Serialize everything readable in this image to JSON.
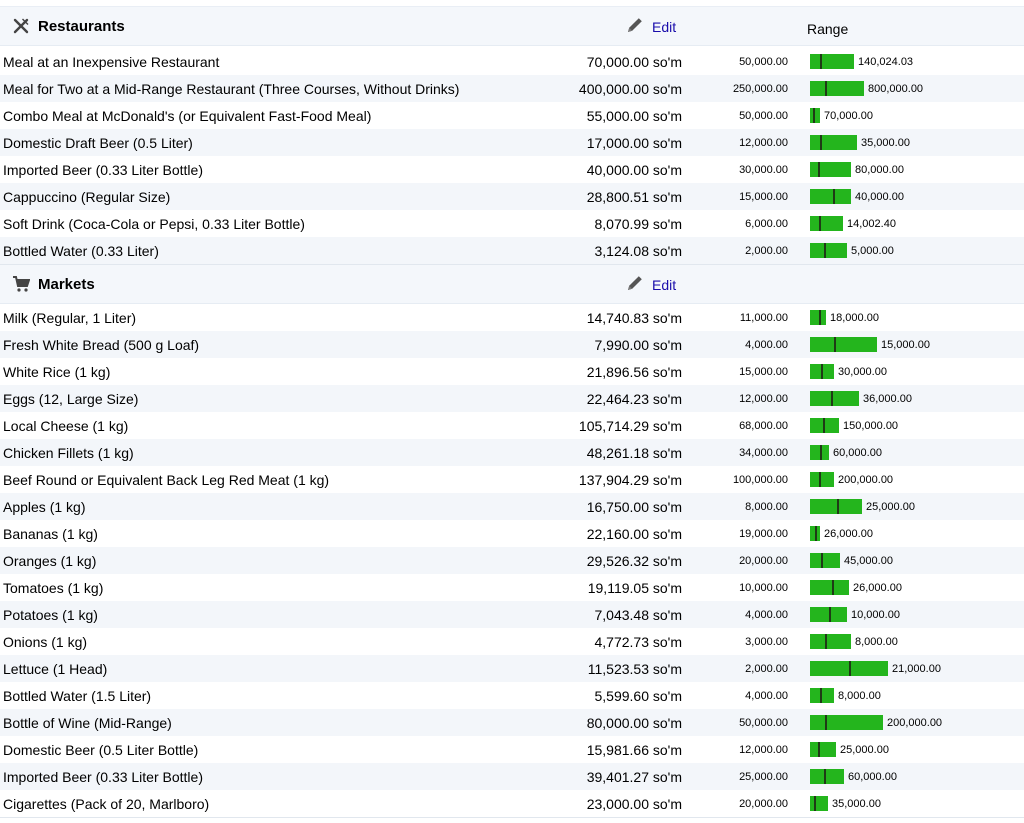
{
  "colors": {
    "bar": "#24b51d",
    "marker": "#1f3a16",
    "link": "#1a0dab"
  },
  "sections": [
    {
      "id": "restaurants",
      "title": "Restaurants",
      "icon": "restaurant-icon",
      "edit_label": "Edit",
      "range_header": "Range",
      "rows": [
        {
          "item": "Meal at an Inexpensive Restaurant",
          "price": "70,000.00 so'm",
          "min": "50,000.00",
          "max": "140,024.03",
          "min_v": 50000,
          "max_v": 140024.03,
          "price_v": 70000
        },
        {
          "item": "Meal for Two at a Mid-Range Restaurant (Three Courses, Without Drinks)",
          "price": "400,000.00 so'm",
          "min": "250,000.00",
          "max": "800,000.00",
          "min_v": 250000,
          "max_v": 800000,
          "price_v": 400000
        },
        {
          "item": "Combo Meal at McDonald's (or Equivalent Fast-Food Meal)",
          "price": "55,000.00 so'm",
          "min": "50,000.00",
          "max": "70,000.00",
          "min_v": 50000,
          "max_v": 70000,
          "price_v": 55000
        },
        {
          "item": "Domestic Draft Beer (0.5 Liter)",
          "price": "17,000.00 so'm",
          "min": "12,000.00",
          "max": "35,000.00",
          "min_v": 12000,
          "max_v": 35000,
          "price_v": 17000
        },
        {
          "item": "Imported Beer (0.33 Liter Bottle)",
          "price": "40,000.00 so'm",
          "min": "30,000.00",
          "max": "80,000.00",
          "min_v": 30000,
          "max_v": 80000,
          "price_v": 40000
        },
        {
          "item": "Cappuccino (Regular Size)",
          "price": "28,800.51 so'm",
          "min": "15,000.00",
          "max": "40,000.00",
          "min_v": 15000,
          "max_v": 40000,
          "price_v": 28800.51
        },
        {
          "item": "Soft Drink (Coca-Cola or Pepsi, 0.33 Liter Bottle)",
          "price": "8,070.99 so'm",
          "min": "6,000.00",
          "max": "14,002.40",
          "min_v": 6000,
          "max_v": 14002.4,
          "price_v": 8070.99
        },
        {
          "item": "Bottled Water (0.33 Liter)",
          "price": "3,124.08 so'm",
          "min": "2,000.00",
          "max": "5,000.00",
          "min_v": 2000,
          "max_v": 5000,
          "price_v": 3124.08
        }
      ]
    },
    {
      "id": "markets",
      "title": "Markets",
      "icon": "shopping-cart-icon",
      "edit_label": "Edit",
      "range_header": "",
      "rows": [
        {
          "item": "Milk (Regular, 1 Liter)",
          "price": "14,740.83 so'm",
          "min": "11,000.00",
          "max": "18,000.00",
          "min_v": 11000,
          "max_v": 18000,
          "price_v": 14740.83
        },
        {
          "item": "Fresh White Bread (500 g Loaf)",
          "price": "7,990.00 so'm",
          "min": "4,000.00",
          "max": "15,000.00",
          "min_v": 4000,
          "max_v": 15000,
          "price_v": 7990
        },
        {
          "item": "White Rice (1 kg)",
          "price": "21,896.56 so'm",
          "min": "15,000.00",
          "max": "30,000.00",
          "min_v": 15000,
          "max_v": 30000,
          "price_v": 21896.56
        },
        {
          "item": "Eggs (12, Large Size)",
          "price": "22,464.23 so'm",
          "min": "12,000.00",
          "max": "36,000.00",
          "min_v": 12000,
          "max_v": 36000,
          "price_v": 22464.23
        },
        {
          "item": "Local Cheese (1 kg)",
          "price": "105,714.29 so'm",
          "min": "68,000.00",
          "max": "150,000.00",
          "min_v": 68000,
          "max_v": 150000,
          "price_v": 105714.29
        },
        {
          "item": "Chicken Fillets (1 kg)",
          "price": "48,261.18 so'm",
          "min": "34,000.00",
          "max": "60,000.00",
          "min_v": 34000,
          "max_v": 60000,
          "price_v": 48261.18
        },
        {
          "item": "Beef Round or Equivalent Back Leg Red Meat (1 kg)",
          "price": "137,904.29 so'm",
          "min": "100,000.00",
          "max": "200,000.00",
          "min_v": 100000,
          "max_v": 200000,
          "price_v": 137904.29
        },
        {
          "item": "Apples (1 kg)",
          "price": "16,750.00 so'm",
          "min": "8,000.00",
          "max": "25,000.00",
          "min_v": 8000,
          "max_v": 25000,
          "price_v": 16750
        },
        {
          "item": "Bananas (1 kg)",
          "price": "22,160.00 so'm",
          "min": "19,000.00",
          "max": "26,000.00",
          "min_v": 19000,
          "max_v": 26000,
          "price_v": 22160
        },
        {
          "item": "Oranges (1 kg)",
          "price": "29,526.32 so'm",
          "min": "20,000.00",
          "max": "45,000.00",
          "min_v": 20000,
          "max_v": 45000,
          "price_v": 29526.32
        },
        {
          "item": "Tomatoes (1 kg)",
          "price": "19,119.05 so'm",
          "min": "10,000.00",
          "max": "26,000.00",
          "min_v": 10000,
          "max_v": 26000,
          "price_v": 19119.05
        },
        {
          "item": "Potatoes (1 kg)",
          "price": "7,043.48 so'm",
          "min": "4,000.00",
          "max": "10,000.00",
          "min_v": 4000,
          "max_v": 10000,
          "price_v": 7043.48
        },
        {
          "item": "Onions (1 kg)",
          "price": "4,772.73 so'm",
          "min": "3,000.00",
          "max": "8,000.00",
          "min_v": 3000,
          "max_v": 8000,
          "price_v": 4772.73
        },
        {
          "item": "Lettuce (1 Head)",
          "price": "11,523.53 so'm",
          "min": "2,000.00",
          "max": "21,000.00",
          "min_v": 2000,
          "max_v": 21000,
          "price_v": 11523.53
        },
        {
          "item": "Bottled Water (1.5 Liter)",
          "price": "5,599.60 so'm",
          "min": "4,000.00",
          "max": "8,000.00",
          "min_v": 4000,
          "max_v": 8000,
          "price_v": 5599.6
        },
        {
          "item": "Bottle of Wine (Mid-Range)",
          "price": "80,000.00 so'm",
          "min": "50,000.00",
          "max": "200,000.00",
          "min_v": 50000,
          "max_v": 200000,
          "price_v": 80000
        },
        {
          "item": "Domestic Beer (0.5 Liter Bottle)",
          "price": "15,981.66 so'm",
          "min": "12,000.00",
          "max": "25,000.00",
          "min_v": 12000,
          "max_v": 25000,
          "price_v": 15981.66
        },
        {
          "item": "Imported Beer (0.33 Liter Bottle)",
          "price": "39,401.27 so'm",
          "min": "25,000.00",
          "max": "60,000.00",
          "min_v": 25000,
          "max_v": 60000,
          "price_v": 39401.27
        },
        {
          "item": "Cigarettes (Pack of 20, Marlboro)",
          "price": "23,000.00 so'm",
          "min": "20,000.00",
          "max": "35,000.00",
          "min_v": 20000,
          "max_v": 35000,
          "price_v": 23000
        }
      ]
    }
  ]
}
